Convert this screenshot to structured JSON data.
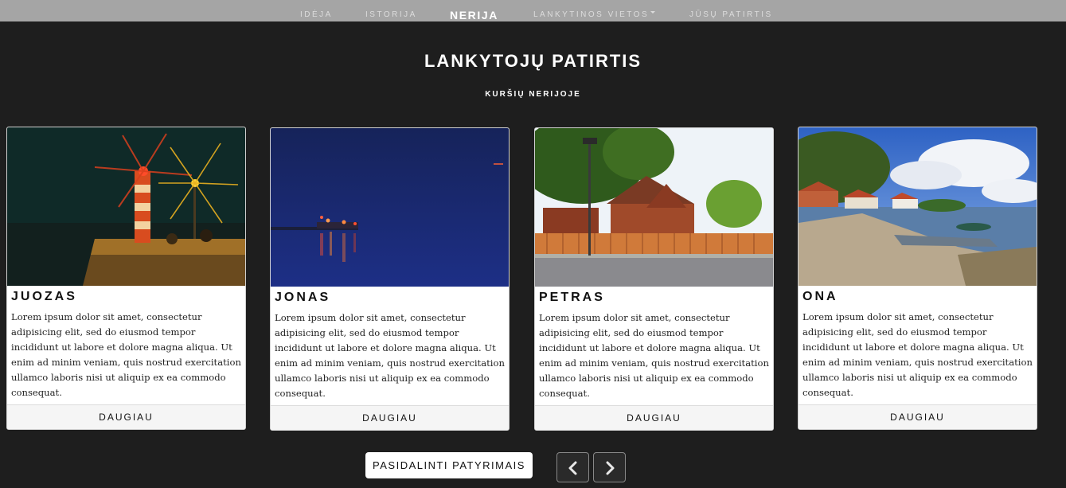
{
  "nav": {
    "items": [
      {
        "label": "IDĖJA"
      },
      {
        "label": "ISTORIJA"
      },
      {
        "label": "NERIJA"
      },
      {
        "label": "LANKYTINOS VIETOS"
      },
      {
        "label": "JŪSŲ PATIRTIS"
      }
    ],
    "active_index": 2
  },
  "header": {
    "title": "LANKYTOJŲ PATIRTIS",
    "subtitle": "KURŠIŲ NERIJOJE"
  },
  "cards": [
    {
      "name": "JUOZAS",
      "image": "lighthouse-night-photo",
      "text": "Lorem ipsum dolor sit amet, consectetur adipisicing elit, sed do eiusmod tempor incididunt ut labore et dolore magna aliqua. Ut enim ad minim veniam, quis nostrud exercitation ullamco laboris nisi ut aliquip ex ea commodo consequat.",
      "button": "DAUGIAU"
    },
    {
      "name": "JONAS",
      "image": "harbor-night-photo",
      "text": "Lorem ipsum dolor sit amet, consectetur adipisicing elit, sed do eiusmod tempor incididunt ut labore et dolore magna aliqua. Ut enim ad minim veniam, quis nostrud exercitation ullamco laboris nisi ut aliquip ex ea commodo consequat.",
      "button": "DAUGIAU"
    },
    {
      "name": "PETRAS",
      "image": "village-street-photo",
      "text": "Lorem ipsum dolor sit amet, consectetur adipisicing elit, sed do eiusmod tempor incididunt ut labore et dolore magna aliqua. Ut enim ad minim veniam, quis nostrud exercitation ullamco laboris nisi ut aliquip ex ea commodo consequat.",
      "button": "DAUGIAU"
    },
    {
      "name": "ONA",
      "image": "lagoon-shore-photo",
      "text": "Lorem ipsum dolor sit amet, consectetur adipisicing elit, sed do eiusmod tempor incididunt ut labore et dolore magna aliqua. Ut enim ad minim veniam, quis nostrud exercitation ullamco laboris nisi ut aliquip ex ea commodo consequat.",
      "button": "DAUGIAU"
    }
  ],
  "actions": {
    "share_label": "PASIDALINTI PATYRIMAIS",
    "prev_icon": "chevron-left-icon",
    "next_icon": "chevron-right-icon"
  },
  "colors": {
    "background": "#1e1e1e",
    "navbar": "#a5a5a5",
    "card": "#ffffff"
  }
}
